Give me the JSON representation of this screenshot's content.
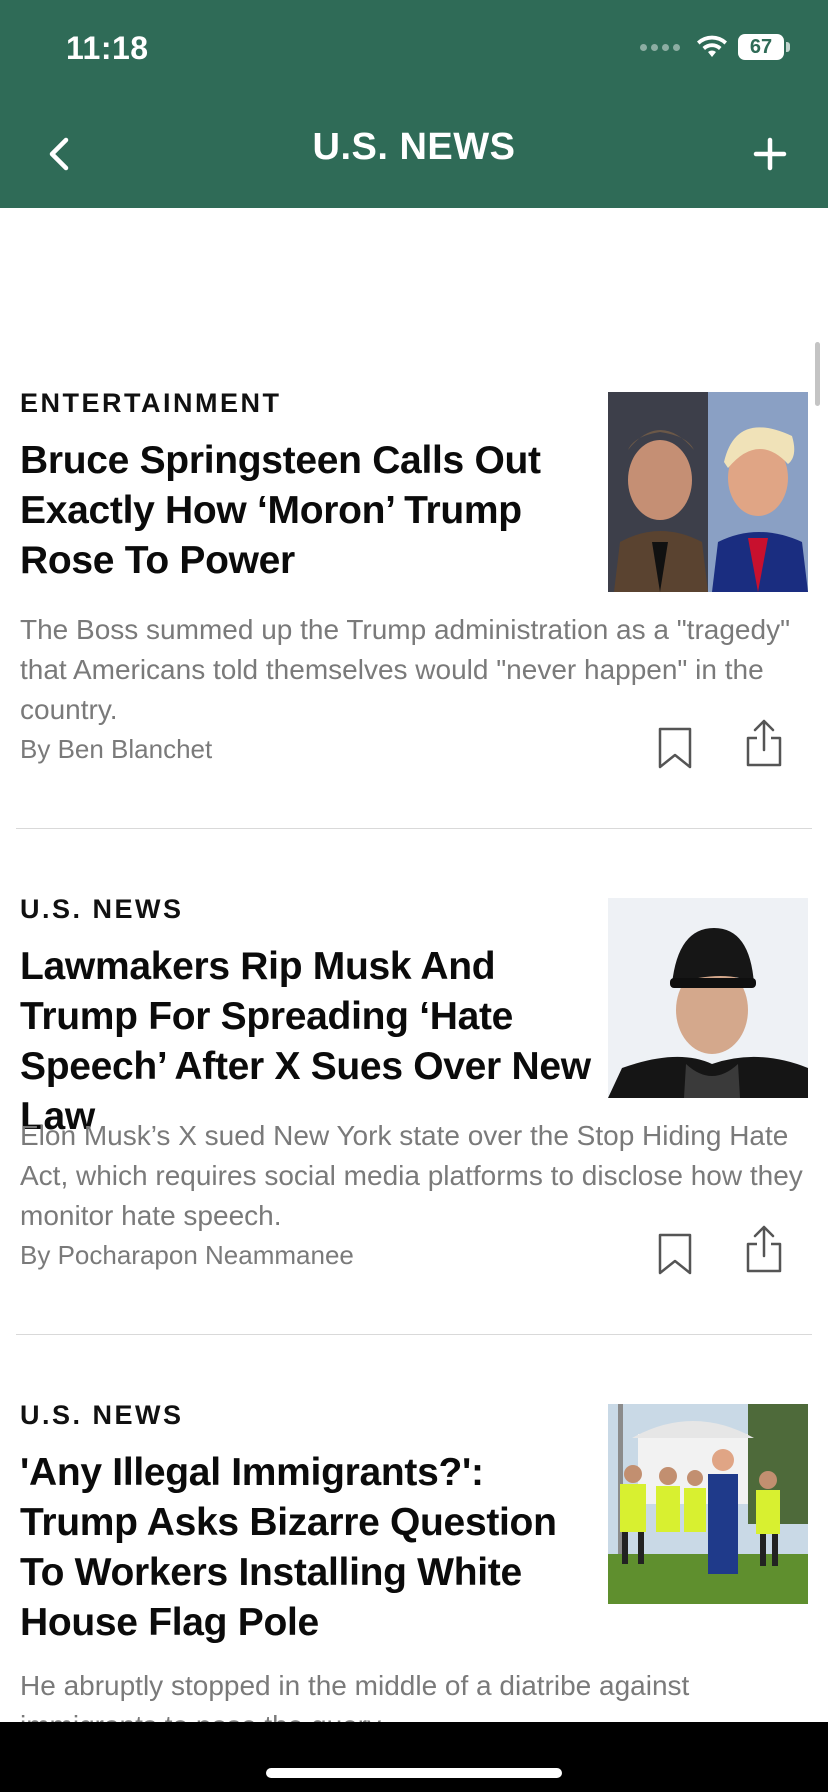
{
  "status_bar": {
    "time": "11:18",
    "battery": "67"
  },
  "nav": {
    "title": "U.S. NEWS"
  },
  "articles": [
    {
      "category": "ENTERTAINMENT",
      "headline": "Bruce Springsteen Calls Out Exactly How ‘Moron’ Trump Rose To Power",
      "summary": "The Boss summed up the Trump administration as a \"tragedy\" that Americans told themselves would \"never happen\" in the country.",
      "byline": "By Ben Blanchet"
    },
    {
      "category": "U.S. NEWS",
      "headline": "Lawmakers Rip Musk And Trump For Spreading ‘Hate Speech’ After X Sues Over New Law",
      "summary": "Elon Musk’s X sued New York state over the Stop Hiding Hate Act, which requires social  media platforms to disclose how they monitor hate speech.",
      "byline": "By Pocharapon Neammanee"
    },
    {
      "category": "U.S. NEWS",
      "headline": "'Any Illegal Immigrants?': Trump Asks Bizarre Question To Workers Installing White House Flag Pole",
      "summary": "He abruptly stopped in the middle of a diatribe against immigrants to pose the query."
    }
  ],
  "icons": {
    "back": "chevron-left-icon",
    "add": "plus-icon",
    "bookmark": "bookmark-icon",
    "share": "share-icon"
  },
  "colors": {
    "header": "#2f6b57",
    "text_muted": "#7a7a7a"
  }
}
